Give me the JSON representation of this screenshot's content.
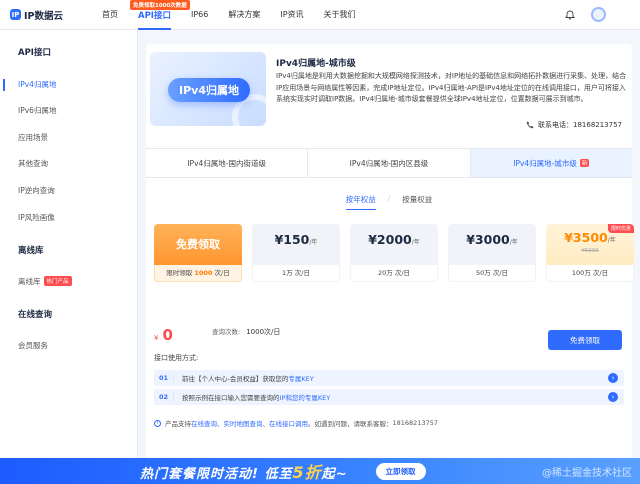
{
  "brand": {
    "logo_mark": "IP",
    "name": "IP数据云"
  },
  "nav": {
    "items": [
      {
        "label": "首页"
      },
      {
        "label": "API接口"
      },
      {
        "label": "IP66"
      },
      {
        "label": "解决方案"
      },
      {
        "label": "IP资讯"
      },
      {
        "label": "关于我们"
      }
    ],
    "badge": "免费领取1000次数据"
  },
  "sidebar": {
    "api_title": "API接口",
    "api_items": [
      {
        "label": "IPv4归属地"
      },
      {
        "label": "IPv6归属地"
      },
      {
        "label": "应用场景"
      },
      {
        "label": "其他查询"
      },
      {
        "label": "IP逆向查询"
      },
      {
        "label": "IP风险画像"
      }
    ],
    "offline_title": "离线库",
    "offline_item": "离线库",
    "hot_badge": "热门产品",
    "online_title": "在线查询",
    "member_item": "会员服务"
  },
  "product": {
    "banner_text": "IPv4归属地",
    "title": "IPv4归属地-城市级",
    "desc": "IPv4归属地是利用大数据挖掘和大规模网络探测技术，对IP地址的基础信息和网络拓扑数据进行采集、处理，结合IP应用场景与网络属性等因素，完成IP地址定位。IPv4归属地-API是IPv4地址定位的在线调用接口，用户可将接入系统实现实时调取IP数据。IPv4归属地-城市级套餐提供全球IPv4地址定位，位置数据可展示到城市。",
    "phone_label": "联系电话：",
    "phone": "18168213757"
  },
  "tabs": [
    {
      "label": "IPv4归属地-国内街道级"
    },
    {
      "label": "IPv4归属地-国内区县级"
    },
    {
      "label": "IPv4归属地-城市级",
      "badge": "新"
    }
  ],
  "subtabs": {
    "year": "按年权益",
    "sep": "/",
    "quantity": "按量权益"
  },
  "packages": {
    "free": {
      "label": "免费领取",
      "foot_pre": "限时领取 ",
      "foot_num": "1000",
      "foot_post": " 次/日"
    },
    "p1": {
      "price": "¥150",
      "unit": "/年",
      "foot": "1万 次/日"
    },
    "p2": {
      "price": "¥2000",
      "unit": "/年",
      "foot": "20万 次/日"
    },
    "p3": {
      "price": "¥3000",
      "unit": "/年",
      "foot": "50万 次/日"
    },
    "p4": {
      "price": "¥3500",
      "unit": "/年",
      "old": "¥5000",
      "foot": "100万 次/日",
      "corner": "限时优惠"
    }
  },
  "order": {
    "currency": "¥",
    "total": "0",
    "query_label": "查询次数:",
    "query_value": "1000次/日",
    "button": "免费领取"
  },
  "usage": {
    "label": "接口使用方式:",
    "steps": [
      {
        "num": "01",
        "pre": "前往【个人中心-会员权益】获取您的",
        "link": "专属KEY"
      },
      {
        "num": "02",
        "pre": "按照示例在接口输入您需要查询的",
        "link": "IP和您的专属KEY"
      }
    ]
  },
  "note": {
    "pre": "产品支持",
    "l1": "在线查询",
    "s1": "、",
    "l2": "实时地图查询",
    "s2": "、",
    "l3": "在线接口调用",
    "post": "。如遇到问题，请联系客服：",
    "phone": "18168213757"
  },
  "promo": {
    "text": "热门套餐限时活动!  低至",
    "highlight": "5折",
    "post": "起~",
    "button": "立即领取",
    "watermark": "@稀土掘金技术社区"
  },
  "colors": {
    "accent": "#2f6bff",
    "orange": "#ff8a1e",
    "red": "#ff4d4f"
  }
}
